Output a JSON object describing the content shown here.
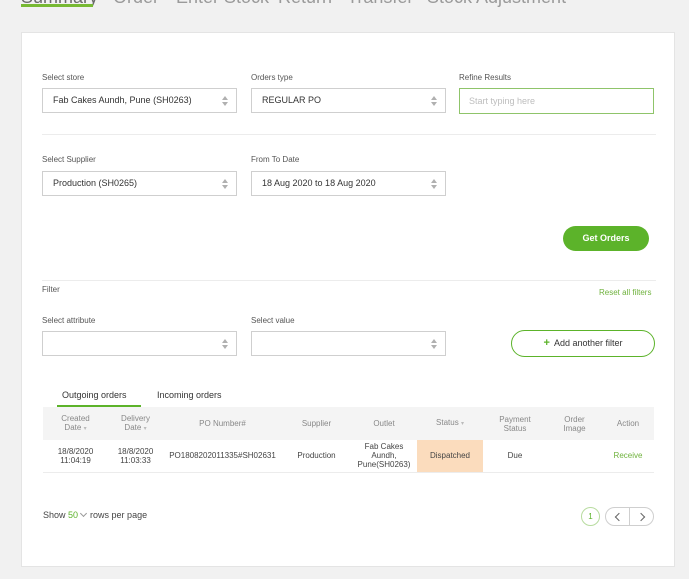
{
  "top_tabs": [
    "Summary",
    "Order",
    "Enter Stock",
    "Return",
    "Transfer",
    "Stock Adjustment"
  ],
  "form": {
    "store": {
      "label": "Select store",
      "value": "Fab Cakes Aundh, Pune (SH0263)"
    },
    "orders_type": {
      "label": "Orders type",
      "value": "REGULAR PO"
    },
    "refine": {
      "label": "Refine Results",
      "placeholder": "Start typing here"
    },
    "supplier": {
      "label": "Select Supplier",
      "value": "Production (SH0265)"
    },
    "date_range": {
      "label": "From To Date",
      "value": "18 Aug 2020 to 18 Aug 2020"
    },
    "get_orders": "Get Orders"
  },
  "filter": {
    "title": "Filter",
    "reset": "Reset all filters",
    "attribute_label": "Select attribute",
    "value_label": "Select value",
    "add_filter": "Add another filter"
  },
  "sub_tabs": [
    "Outgoing orders",
    "Incoming orders"
  ],
  "table": {
    "headers": [
      {
        "line1": "Created",
        "line2": "Date",
        "sortable": true
      },
      {
        "line1": "Delivery",
        "line2": "Date",
        "sortable": true
      },
      {
        "line1": "PO Number#",
        "line2": "",
        "sortable": false
      },
      {
        "line1": "Supplier",
        "line2": "",
        "sortable": false
      },
      {
        "line1": "Outlet",
        "line2": "",
        "sortable": false
      },
      {
        "line1": "Status",
        "line2": "",
        "sortable": true
      },
      {
        "line1": "Payment",
        "line2": "Status",
        "sortable": false
      },
      {
        "line1": "Order",
        "line2": "Image",
        "sortable": false
      },
      {
        "line1": "Action",
        "line2": "",
        "sortable": false
      }
    ],
    "rows": [
      {
        "created_date": "18/8/2020",
        "created_time": "11:04:19",
        "delivery_date": "18/8/2020",
        "delivery_time": "11:03:33",
        "po_number": "PO1808202011335#SH02631",
        "supplier": "Production",
        "outlet_1": "Fab Cakes",
        "outlet_2": "Aundh,",
        "outlet_3": "Pune(SH0263)",
        "status": "Dispatched",
        "payment_status": "Due",
        "order_image": "",
        "action": "Receive"
      }
    ]
  },
  "pagination": {
    "show": "Show",
    "rows_per_page": "50",
    "suffix": "rows per page",
    "current_page": "1"
  },
  "colors": {
    "accent": "#5cb32a",
    "status_dispatched": "#fbdcbd"
  }
}
